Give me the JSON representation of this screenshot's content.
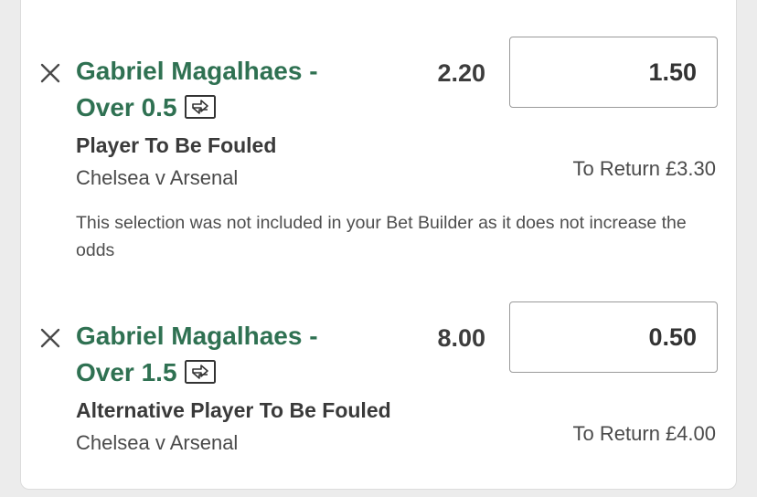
{
  "colors": {
    "accent": "#2f7152",
    "text": "#3a3a3a"
  },
  "selections": [
    {
      "remove_icon": "close-icon",
      "title": "Gabriel Magalhaes - Over 0.5",
      "swap_icon": "swap-arrows-icon",
      "odds": "2.20",
      "stake": "1.50",
      "market": "Player To Be Fouled",
      "event": "Chelsea v Arsenal",
      "to_return_label": "To Return",
      "to_return_amount": "£3.30",
      "notice": "This selection was not included in your Bet Builder as it does not increase the odds"
    },
    {
      "remove_icon": "close-icon",
      "title": "Gabriel Magalhaes - Over 1.5",
      "swap_icon": "swap-arrows-icon",
      "odds": "8.00",
      "stake": "0.50",
      "market": "Alternative Player To Be Fouled",
      "event": "Chelsea v Arsenal",
      "to_return_label": "To Return",
      "to_return_amount": "£4.00"
    }
  ]
}
